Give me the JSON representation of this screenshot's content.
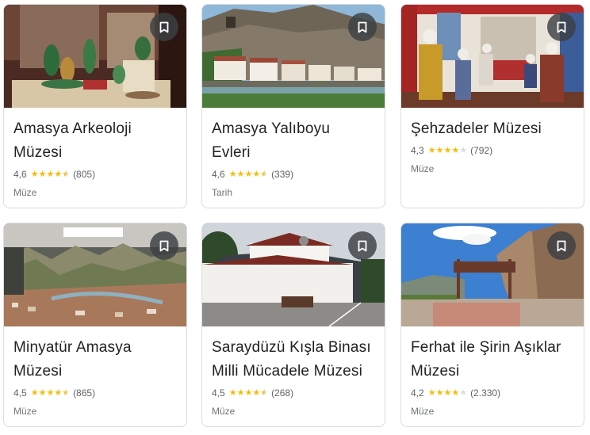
{
  "colors": {
    "star": "#fbbc04",
    "star_empty": "#dadce0",
    "save_button_bg": "#3c4043"
  },
  "places": [
    {
      "title_line1": "Amasya Arkeoloji",
      "title_line2": "Müzesi",
      "rating": "4,6",
      "rating_value": 4.6,
      "reviews": "(805)",
      "category": "Müze",
      "photo": "museum-display-case"
    },
    {
      "title_line1": "Amasya Yalıboyu",
      "title_line2": "Evleri",
      "rating": "4,6",
      "rating_value": 4.6,
      "reviews": "(339)",
      "category": "Tarih",
      "photo": "riverside-houses-cliff"
    },
    {
      "title_line1": "Şehzadeler Müzesi",
      "title_line2": "",
      "rating": "4,3",
      "rating_value": 4.3,
      "reviews": "(792)",
      "category": "Müze",
      "photo": "ottoman-figures-room"
    },
    {
      "title_line1": "Minyatür Amasya",
      "title_line2": "Müzesi",
      "rating": "4,5",
      "rating_value": 4.5,
      "reviews": "(865)",
      "category": "Müze",
      "photo": "miniature-city-model"
    },
    {
      "title_line1": "Saraydüzü Kışla Binası",
      "title_line2": "Milli Mücadele Müzesi",
      "rating": "4,5",
      "rating_value": 4.5,
      "reviews": "(268)",
      "category": "Müze",
      "photo": "white-barracks-building"
    },
    {
      "title_line1": "Ferhat ile Şirin Aşıklar",
      "title_line2": "Müzesi",
      "rating": "4,2",
      "rating_value": 4.2,
      "reviews": "(2.330)",
      "category": "Müze",
      "photo": "entrance-gate-rock"
    }
  ]
}
